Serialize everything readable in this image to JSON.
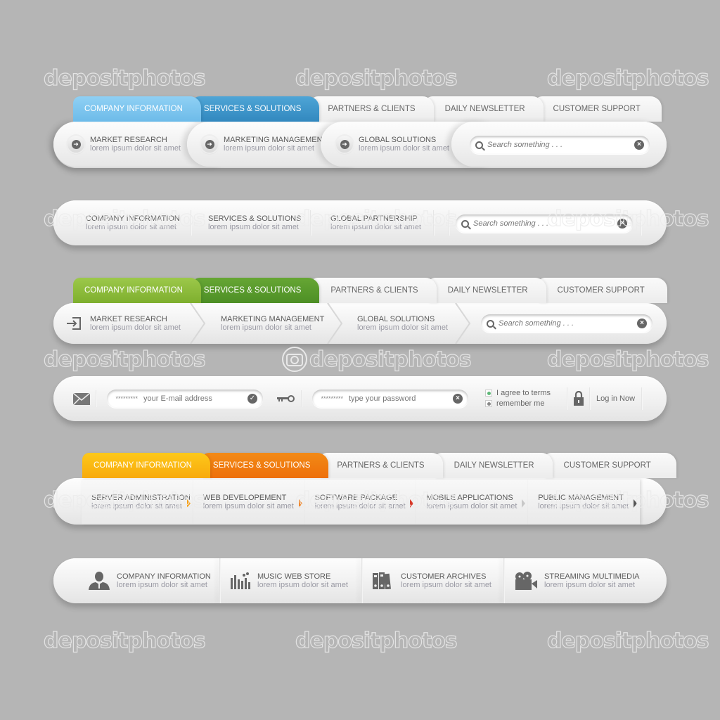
{
  "watermark": "depositphotos",
  "colors": {
    "blue_tab_1": "#7cc6ef",
    "blue_tab_2": "#3e94c9",
    "green_tab_1": "#8fbc3a",
    "green_tab_2": "#5a9a2c",
    "orange_tab_1": "#fbb713",
    "orange_tab_2": "#f0790e",
    "background": "#b5b5b5"
  },
  "tabs": [
    "COMPANY INFORMATION",
    "SERVICES & SOLUTIONS",
    "PARTNERS & CLIENTS",
    "DAILY NEWSLETTER",
    "CUSTOMER SUPPORT"
  ],
  "nav1": {
    "items": [
      {
        "title": "MARKET RESEARCH",
        "sub": "lorem ipsum dolor sit amet"
      },
      {
        "title": "MARKETING MANAGEMENT",
        "sub": "lorem ipsum dolor sit amet"
      },
      {
        "title": "GLOBAL SOLUTIONS",
        "sub": "lorem ipsum dolor sit amet"
      }
    ],
    "search_placeholder": "Search something . . ."
  },
  "nav2": {
    "items": [
      {
        "title": "COMPANY INFORMATION",
        "sub": "lorem ipsum dolor sit amet"
      },
      {
        "title": "SERVICES & SOLUTIONS",
        "sub": "lorem ipsum dolor sit amet"
      },
      {
        "title": "GLOBAL PARTNERSHIP",
        "sub": "lorem ipsum dolor sit amet"
      }
    ],
    "search_placeholder": "Search something . . ."
  },
  "nav3": {
    "items": [
      {
        "title": "MARKET RESEARCH",
        "sub": "lorem ipsum dolor sit amet"
      },
      {
        "title": "MARKETING MANAGEMENT",
        "sub": "lorem ipsum dolor sit amet"
      },
      {
        "title": "GLOBAL SOLUTIONS",
        "sub": "lorem ipsum dolor sit amet"
      }
    ],
    "search_placeholder": "Search something . . ."
  },
  "login": {
    "email_mask": "*********",
    "email_placeholder": "your E-mail address",
    "password_mask": "*********",
    "password_placeholder": "type your password",
    "agree_label": "I agree to terms",
    "remember_label": "remember me",
    "login_label": "Log in Now"
  },
  "nav4": {
    "items": [
      {
        "title": "SERVER ADMINISTRATION",
        "sub": "lorem ipsum dolor sit amet"
      },
      {
        "title": "WEB DEVELOPEMENT",
        "sub": "lorem ipsum dolor sit amet"
      },
      {
        "title": "SOFTWARE PACKAGE",
        "sub": "lorem ipsum dolor sit amet"
      },
      {
        "title": "MOBILE APPLICATIONS",
        "sub": "lorem ipsum dolor sit amet"
      },
      {
        "title": "PUBLIC MANAGEMENT",
        "sub": "lorem ipsum dolor sit amet"
      }
    ]
  },
  "nav5": {
    "items": [
      {
        "title": "COMPANY INFORMATION",
        "sub": "lorem ipsum dolor sit amet",
        "icon": "user-icon"
      },
      {
        "title": "MUSIC WEB STORE",
        "sub": "lorem ipsum dolor sit amet",
        "icon": "music-chart-icon"
      },
      {
        "title": "CUSTOMER ARCHIVES",
        "sub": "lorem ipsum dolor sit amet",
        "icon": "binders-icon"
      },
      {
        "title": "STREAMING MULTIMEDIA",
        "sub": "lorem ipsum dolor sit amet",
        "icon": "video-camera-icon"
      }
    ]
  }
}
